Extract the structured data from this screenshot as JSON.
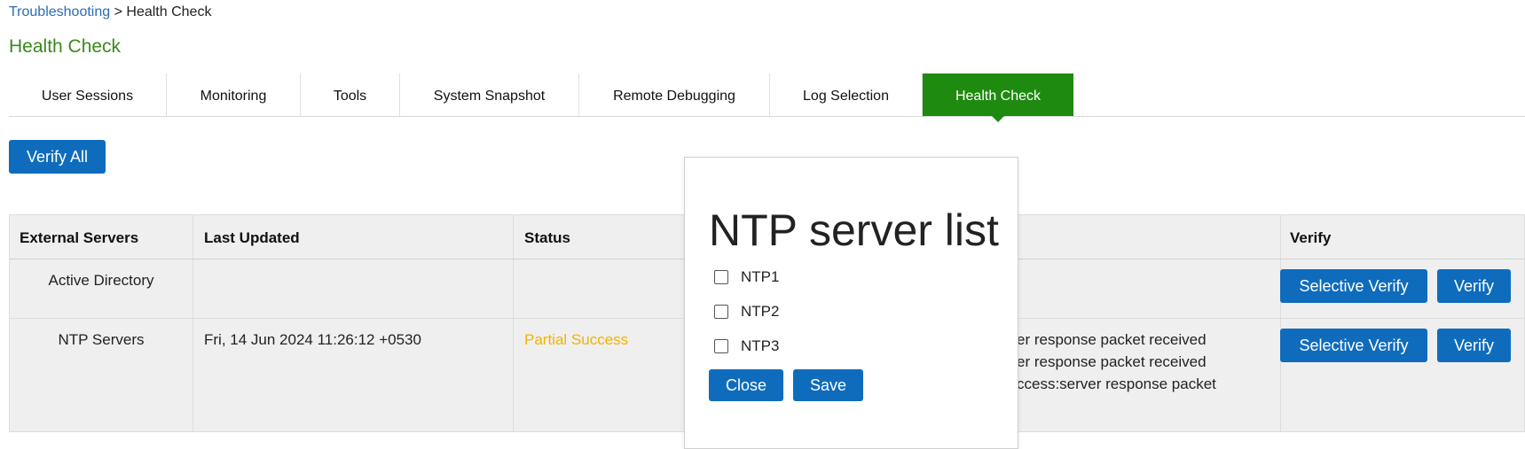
{
  "breadcrumb": {
    "parent": "Troubleshooting",
    "separator": " > ",
    "current": "Health Check"
  },
  "page_title": "Health Check",
  "tabs": [
    {
      "label": "User Sessions",
      "active": false
    },
    {
      "label": "Monitoring",
      "active": false
    },
    {
      "label": "Tools",
      "active": false
    },
    {
      "label": "System Snapshot",
      "active": false
    },
    {
      "label": "Remote Debugging",
      "active": false
    },
    {
      "label": "Log Selection",
      "active": false
    },
    {
      "label": "Health Check",
      "active": true
    }
  ],
  "verify_all_label": "Verify All",
  "table": {
    "headers": {
      "external_servers": "External Servers",
      "last_updated": "Last Updated",
      "status": "Status",
      "verify": "Verify"
    },
    "rows": [
      {
        "server": "Active Directory",
        "last_updated": "",
        "status": "",
        "details": [],
        "selective_verify": "Selective Verify",
        "verify": "Verify"
      },
      {
        "server": "NTP Servers",
        "last_updated": "Fri, 14 Jun 2024 11:26:12 +0530",
        "status": "Partial Success",
        "details": [
          "er response packet received",
          "er response packet received",
          "ccess:server response packet"
        ],
        "selective_verify": "Selective Verify",
        "verify": "Verify"
      }
    ]
  },
  "modal": {
    "title": "NTP server list",
    "options": [
      {
        "label": "NTP1",
        "checked": false
      },
      {
        "label": "NTP2",
        "checked": false
      },
      {
        "label": "NTP3",
        "checked": false
      }
    ],
    "close_label": "Close",
    "save_label": "Save"
  },
  "colors": {
    "accent_green": "#1f8a10",
    "title_green": "#3a8a1a",
    "button_blue": "#0f6cbd",
    "link_blue": "#2a6db5",
    "status_partial": "#f3b300"
  }
}
